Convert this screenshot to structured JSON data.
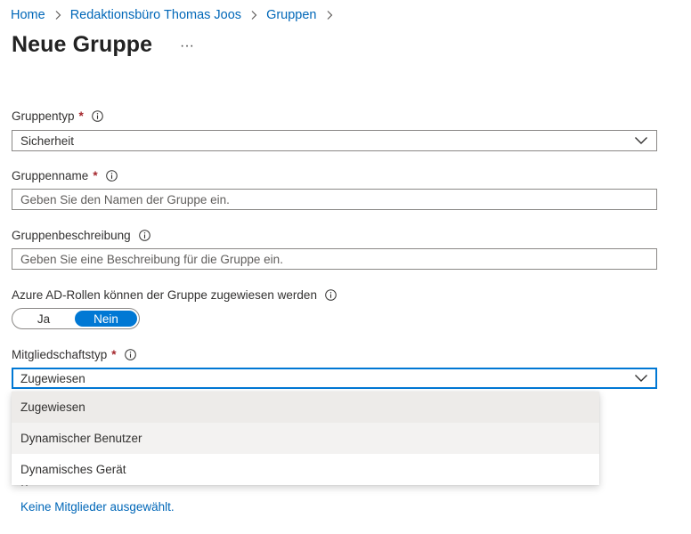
{
  "breadcrumb": {
    "items": [
      "Home",
      "Redaktionsbüro Thomas Joos",
      "Gruppen"
    ]
  },
  "page": {
    "title": "Neue Gruppe",
    "more": "···"
  },
  "form": {
    "group_type": {
      "label": "Gruppentyp",
      "required": "*",
      "value": "Sicherheit"
    },
    "group_name": {
      "label": "Gruppenname",
      "required": "*",
      "placeholder": "Geben Sie den Namen der Gruppe ein."
    },
    "group_description": {
      "label": "Gruppenbeschreibung",
      "placeholder": "Geben Sie eine Beschreibung für die Gruppe ein."
    },
    "azure_roles": {
      "label": "Azure AD-Rollen können der Gruppe zugewiesen werden",
      "options": [
        "Ja",
        "Nein"
      ],
      "selected": "Nein"
    },
    "membership_type": {
      "label": "Mitgliedschaftstyp",
      "required": "*",
      "value": "Zugewiesen",
      "options": [
        "Zugewiesen",
        "Dynamischer Benutzer",
        "Dynamisches Gerät"
      ]
    }
  },
  "members": {
    "empty_link": "Keine Mitglieder ausgewählt."
  },
  "colors": {
    "accent": "#0078d4",
    "link": "#0067b8",
    "required": "#a4262c"
  },
  "icons": {
    "breadcrumb_separator": "chevron-right-icon",
    "info": "info-icon",
    "select": "chevron-down-icon"
  }
}
